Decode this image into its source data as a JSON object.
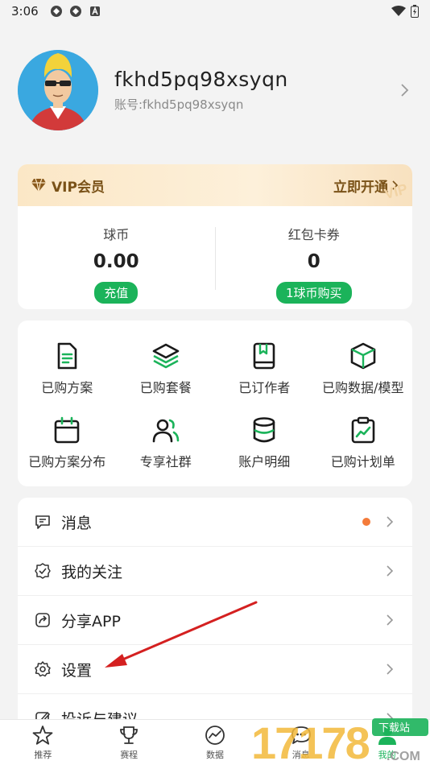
{
  "status_bar": {
    "time": "3:06"
  },
  "profile": {
    "name": "fkhd5pq98xsyqn",
    "account": "账号:fkhd5pq98xsyqn"
  },
  "vip": {
    "label": "VIP会员",
    "action": "立即开通",
    "watermark": "VIP"
  },
  "wallet": {
    "coins": {
      "label": "球币",
      "value": "0.00",
      "button": "充值"
    },
    "coupons": {
      "label": "红包卡券",
      "value": "0",
      "button": "1球币购买"
    }
  },
  "grid": {
    "items": [
      {
        "label": "已购方案",
        "icon": "document-icon"
      },
      {
        "label": "已购套餐",
        "icon": "layers-icon"
      },
      {
        "label": "已订作者",
        "icon": "bookmark-book-icon"
      },
      {
        "label": "已购数据/模型",
        "icon": "cube-icon"
      },
      {
        "label": "已购方案分布",
        "icon": "calendar-icon"
      },
      {
        "label": "专享社群",
        "icon": "users-icon"
      },
      {
        "label": "账户明细",
        "icon": "database-icon"
      },
      {
        "label": "已购计划单",
        "icon": "clipboard-chart-icon"
      }
    ]
  },
  "menu": {
    "items": [
      {
        "label": "消息",
        "icon": "message-icon",
        "has_dot": true
      },
      {
        "label": "我的关注",
        "icon": "check-badge-icon"
      },
      {
        "label": "分享APP",
        "icon": "share-icon"
      },
      {
        "label": "设置",
        "icon": "gear-icon"
      },
      {
        "label": "投诉与建议",
        "icon": "edit-icon"
      }
    ]
  },
  "tabbar": {
    "items": [
      {
        "label": "推荐",
        "icon": "star-icon"
      },
      {
        "label": "赛程",
        "icon": "trophy-icon"
      },
      {
        "label": "数据",
        "icon": "chart-circle-icon"
      },
      {
        "label": "消息",
        "icon": "chat-icon"
      },
      {
        "label": "我的",
        "icon": "user-icon"
      }
    ]
  },
  "watermark": {
    "text": "17178",
    "suffix": ".COM",
    "badge": "下载站"
  },
  "colors": {
    "accent_green": "#1bb35a",
    "vip_gold": "#7a5218",
    "dot_orange": "#f47b3a",
    "annotation_red": "#d42020"
  }
}
